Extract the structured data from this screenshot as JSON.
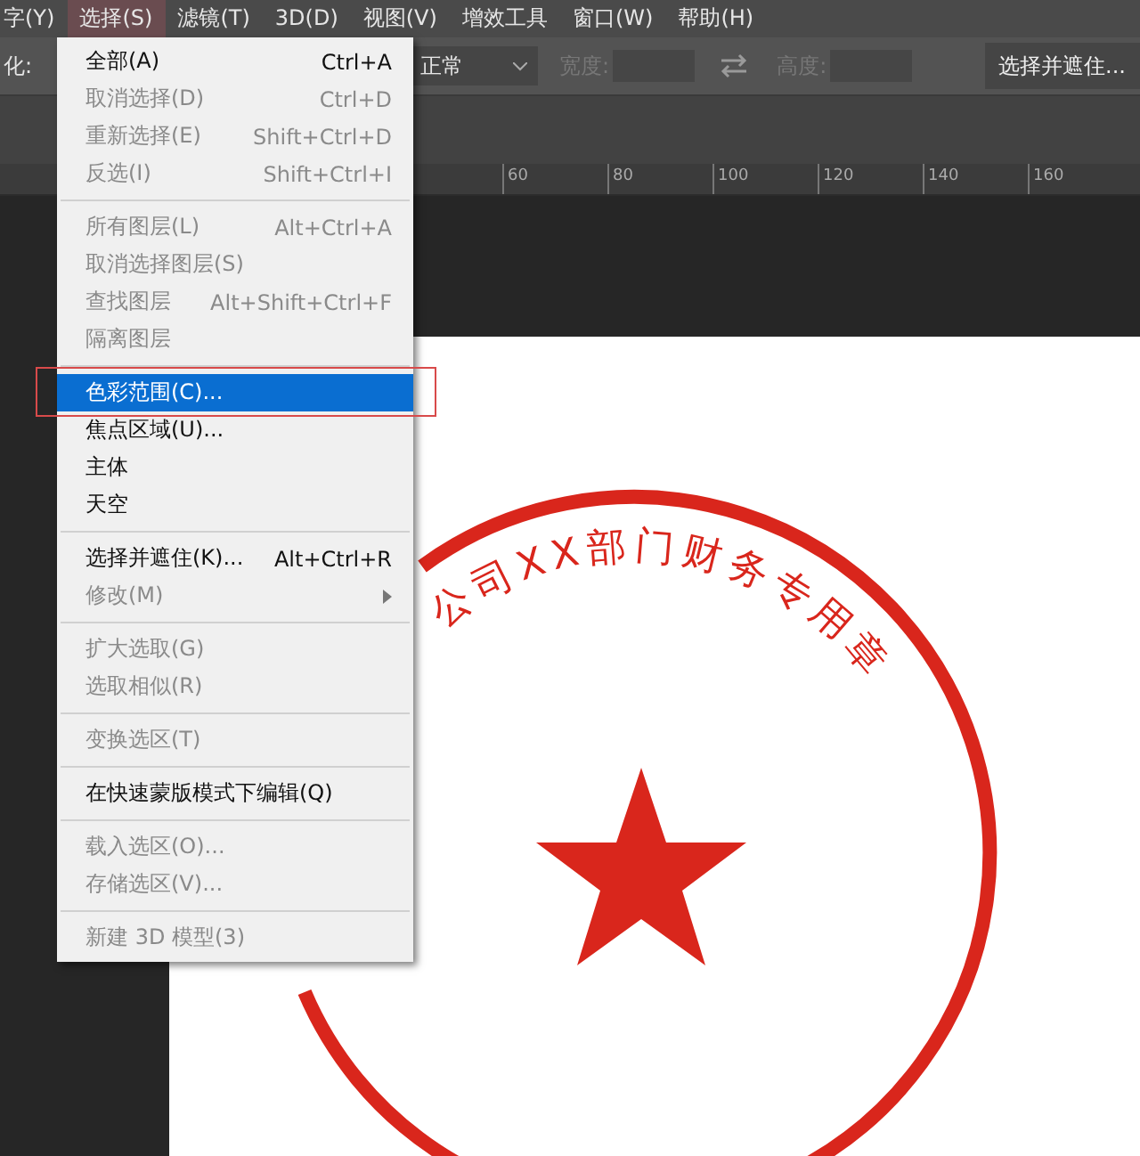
{
  "menubar": [
    {
      "label": "字(Y)",
      "selected": false
    },
    {
      "label": "选择(S)",
      "selected": true
    },
    {
      "label": "滤镜(T)",
      "selected": false
    },
    {
      "label": "3D(D)",
      "selected": false
    },
    {
      "label": "视图(V)",
      "selected": false
    },
    {
      "label": "增效工具",
      "selected": false
    },
    {
      "label": "窗口(W)",
      "selected": false
    },
    {
      "label": "帮助(H)",
      "selected": false
    }
  ],
  "options_bar": {
    "feather_label": "化:",
    "style_value": "正常",
    "width_label": "宽度:",
    "height_label": "高度:",
    "refine_button": "选择并遮住..."
  },
  "ruler": [
    "60",
    "80",
    "100",
    "120",
    "140",
    "160"
  ],
  "menu": [
    {
      "kind": "item",
      "label": "全部(A)",
      "shortcut": "Ctrl+A",
      "disabled": false,
      "selected": false
    },
    {
      "kind": "item",
      "label": "取消选择(D)",
      "shortcut": "Ctrl+D",
      "disabled": true,
      "selected": false
    },
    {
      "kind": "item",
      "label": "重新选择(E)",
      "shortcut": "Shift+Ctrl+D",
      "disabled": true,
      "selected": false
    },
    {
      "kind": "item",
      "label": "反选(I)",
      "shortcut": "Shift+Ctrl+I",
      "disabled": true,
      "selected": false
    },
    {
      "kind": "separator"
    },
    {
      "kind": "item",
      "label": "所有图层(L)",
      "shortcut": "Alt+Ctrl+A",
      "disabled": true,
      "selected": false
    },
    {
      "kind": "item",
      "label": "取消选择图层(S)",
      "disabled": true,
      "selected": false
    },
    {
      "kind": "item",
      "label": "查找图层",
      "shortcut": "Alt+Shift+Ctrl+F",
      "disabled": true,
      "selected": false
    },
    {
      "kind": "item",
      "label": "隔离图层",
      "disabled": true,
      "selected": false
    },
    {
      "kind": "separator"
    },
    {
      "kind": "item",
      "label": "色彩范围(C)...",
      "disabled": false,
      "selected": true
    },
    {
      "kind": "item",
      "label": "焦点区域(U)...",
      "disabled": false,
      "selected": false
    },
    {
      "kind": "item",
      "label": "主体",
      "disabled": false,
      "selected": false
    },
    {
      "kind": "item",
      "label": "天空",
      "disabled": false,
      "selected": false
    },
    {
      "kind": "separator"
    },
    {
      "kind": "item",
      "label": "选择并遮住(K)...",
      "shortcut": "Alt+Ctrl+R",
      "disabled": false,
      "selected": false
    },
    {
      "kind": "item",
      "label": "修改(M)",
      "disabled": true,
      "selected": false,
      "submenu": true
    },
    {
      "kind": "separator"
    },
    {
      "kind": "item",
      "label": "扩大选取(G)",
      "disabled": true,
      "selected": false
    },
    {
      "kind": "item",
      "label": "选取相似(R)",
      "disabled": true,
      "selected": false
    },
    {
      "kind": "separator"
    },
    {
      "kind": "item",
      "label": "变换选区(T)",
      "disabled": true,
      "selected": false
    },
    {
      "kind": "separator"
    },
    {
      "kind": "item",
      "label": "在快速蒙版模式下编辑(Q)",
      "disabled": false,
      "selected": false
    },
    {
      "kind": "separator"
    },
    {
      "kind": "item",
      "label": "载入选区(O)...",
      "disabled": true,
      "selected": false
    },
    {
      "kind": "item",
      "label": "存储选区(V)...",
      "disabled": true,
      "selected": false
    },
    {
      "kind": "separator"
    },
    {
      "kind": "item",
      "label": "新建 3D 模型(3)",
      "disabled": true,
      "selected": false
    }
  ],
  "stamp": {
    "text": "公司XX部门财务专用章"
  }
}
